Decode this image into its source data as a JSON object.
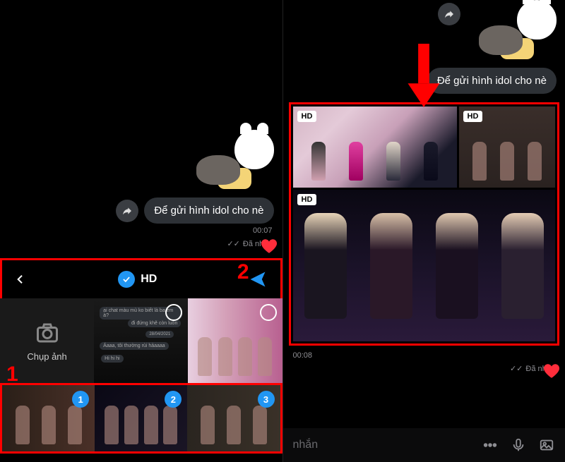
{
  "left": {
    "message": "Để gửi hình idol cho nè",
    "timestamp": "00:07",
    "status": "Đã nhận",
    "picker": {
      "hd_label": "HD",
      "camera_label": "Chụp ảnh",
      "annotation1": "1",
      "annotation2": "2",
      "selection_badges": [
        "1",
        "2",
        "3"
      ]
    }
  },
  "right": {
    "message": "Để gửi hình idol cho nè",
    "timestamp": "00:08",
    "status": "Đã nhận",
    "hd_badge": "HD",
    "input_placeholder": "nhắn"
  }
}
